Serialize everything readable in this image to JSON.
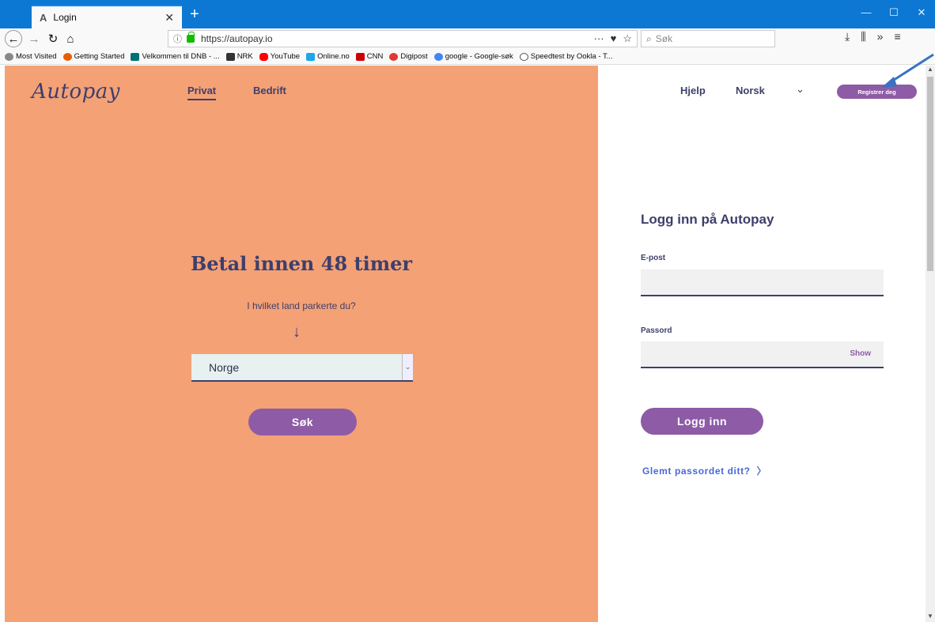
{
  "browser": {
    "tab_title": "Login",
    "tab_favicon": "A",
    "new_tab": "+",
    "url": "https://autopay.io",
    "search_placeholder": "Søk",
    "window_controls": [
      "—",
      "☐",
      "✕"
    ],
    "bookmarks": [
      {
        "label": "Most Visited",
        "color": "#888888"
      },
      {
        "label": "Getting Started",
        "color": "#e66000"
      },
      {
        "label": "Velkommen til DNB - ...",
        "color": "#007272"
      },
      {
        "label": "NRK",
        "color": "#333333"
      },
      {
        "label": "YouTube",
        "color": "#ff0000"
      },
      {
        "label": "Online.no",
        "color": "#1aa7ec"
      },
      {
        "label": "CNN",
        "color": "#cc0000"
      },
      {
        "label": "Digipost",
        "color": "#e23a2e"
      },
      {
        "label": "google - Google-søk",
        "color": "#4285f4"
      },
      {
        "label": "Speedtest by Ookla - T...",
        "color": "#555555"
      }
    ]
  },
  "site": {
    "logo": "Autopay",
    "nav": {
      "privat": "Privat",
      "bedrift": "Bedrift"
    },
    "header": {
      "hjelp": "Hjelp",
      "language": "Norsk",
      "register": "Registrer deg"
    },
    "hero": {
      "title": "Betal innen 48 timer",
      "question": "I hvilket land parkerte du?",
      "arrow": "↓",
      "country_value": "Norge",
      "search_button": "Søk"
    },
    "login": {
      "title": "Logg inn på Autopay",
      "email_label": "E-post",
      "password_label": "Passord",
      "show_label": "Show",
      "login_button": "Logg inn",
      "forgot_link": "Glemt passordet ditt?"
    }
  },
  "colors": {
    "left_panel": "#f4a176",
    "primary_purple": "#8e5ba6",
    "navy_text": "#3d3f6b",
    "link_blue": "#4a67d6",
    "titlebar": "#0c78d4"
  }
}
